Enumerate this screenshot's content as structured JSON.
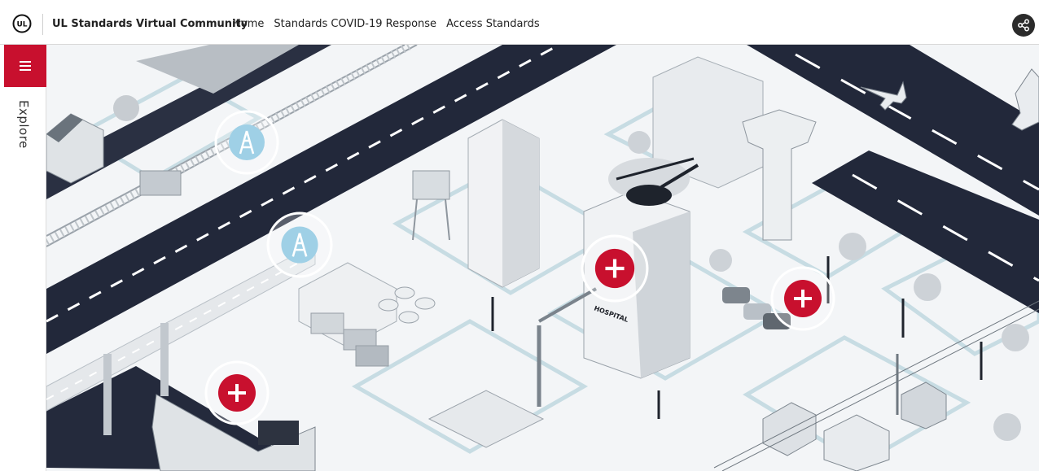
{
  "header": {
    "site_title": "UL Standards Virtual Community",
    "nav": [
      {
        "label": "Home"
      },
      {
        "label": "Standards COVID-19 Response"
      },
      {
        "label": "Access Standards"
      }
    ],
    "logo_text": "UL"
  },
  "sidebar": {
    "explore_label": "Explore"
  },
  "map": {
    "hospital_sign": "HOSPITAL"
  },
  "colors": {
    "brand_red": "#c8102e",
    "hotspot_blue": "#9fd0e6",
    "road": "#22283a"
  },
  "icons": {
    "menu": "hamburger-icon",
    "share": "share-icon",
    "hotspot_plus": "plus-icon",
    "hotspot_tower": "transmission-tower-icon"
  }
}
